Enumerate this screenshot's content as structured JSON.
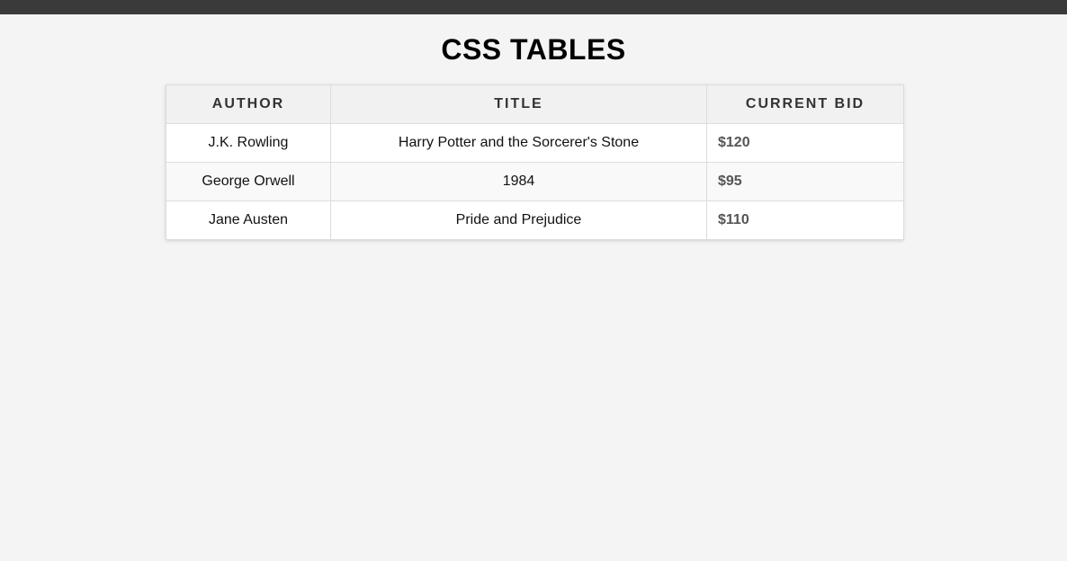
{
  "page": {
    "title": "CSS TABLES"
  },
  "table": {
    "headers": {
      "author": "AUTHOR",
      "title": "TITLE",
      "bid": "CURRENT BID"
    },
    "rows": [
      {
        "author": "J.K. Rowling",
        "title": "Harry Potter and the Sorcerer's Stone",
        "bid": "$120"
      },
      {
        "author": "George Orwell",
        "title": "1984",
        "bid": "$95"
      },
      {
        "author": "Jane Austen",
        "title": "Pride and Prejudice",
        "bid": "$110"
      }
    ]
  }
}
